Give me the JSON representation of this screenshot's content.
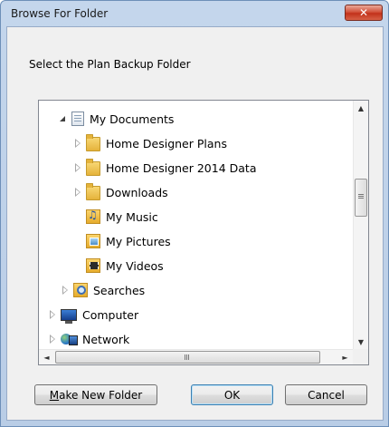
{
  "window": {
    "title": "Browse For Folder",
    "close_glyph": "✕"
  },
  "prompt": "Select the Plan Backup Folder",
  "tree": {
    "items": [
      {
        "label": "My Documents",
        "icon": "documents-icon",
        "expander": "expanded"
      },
      {
        "label": "Home Designer Plans",
        "icon": "folder-icon",
        "expander": "collapsed"
      },
      {
        "label": "Home Designer 2014 Data",
        "icon": "folder-icon",
        "expander": "collapsed"
      },
      {
        "label": "Downloads",
        "icon": "folder-icon",
        "expander": "collapsed"
      },
      {
        "label": "My Music",
        "icon": "music-folder-icon",
        "expander": "none"
      },
      {
        "label": "My Pictures",
        "icon": "pictures-folder-icon",
        "expander": "none"
      },
      {
        "label": "My Videos",
        "icon": "videos-folder-icon",
        "expander": "none"
      },
      {
        "label": "Searches",
        "icon": "searches-folder-icon",
        "expander": "collapsed"
      },
      {
        "label": "Computer",
        "icon": "computer-icon",
        "expander": "collapsed"
      },
      {
        "label": "Network",
        "icon": "network-icon",
        "expander": "collapsed"
      }
    ],
    "scroll_glyphs": {
      "up": "▲",
      "down": "▼",
      "left": "◄",
      "right": "►"
    }
  },
  "buttons": {
    "make_new_folder": "Make New Folder",
    "ok": "OK",
    "cancel": "Cancel"
  },
  "colors": {
    "frame": "#b9cde6",
    "close_button": "#c2321b",
    "client": "#f0f0f0"
  }
}
